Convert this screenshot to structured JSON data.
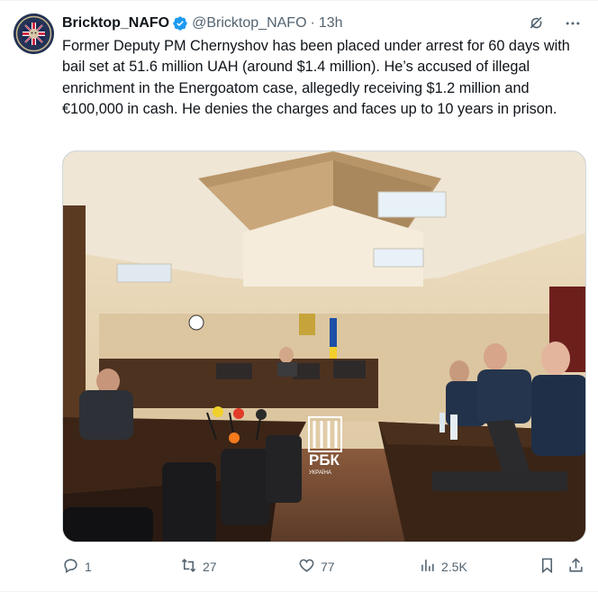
{
  "tweet": {
    "author_name": "Bricktop_NAFO",
    "handle": "@Bricktop_NAFO",
    "separator": "·",
    "time": "13h",
    "text": "Former Deputy PM Chernyshov has been placed under arrest for 60 days with bail set at 51.6 million UAH (around $1.4 million). He’s accused of illegal enrichment in the Energoatom case, allegedly receiving $1.2 million and €100,000 in cash. He denies the charges and faces up to 10 years in prison.",
    "verified": true
  },
  "media": {
    "watermark_main": "РБК",
    "watermark_sub": "УКРАЇНА"
  },
  "actions": {
    "replies": "1",
    "reposts": "27",
    "likes": "77",
    "views": "2.5K"
  },
  "colors": {
    "text": "#0f1419",
    "secondary": "#536471",
    "verified": "#1d9bf0",
    "border": "#cfd9de"
  },
  "icons": [
    "verified-badge-icon",
    "grok-icon",
    "more-icon",
    "reply-icon",
    "repost-icon",
    "like-icon",
    "views-icon",
    "bookmark-icon",
    "share-icon"
  ]
}
